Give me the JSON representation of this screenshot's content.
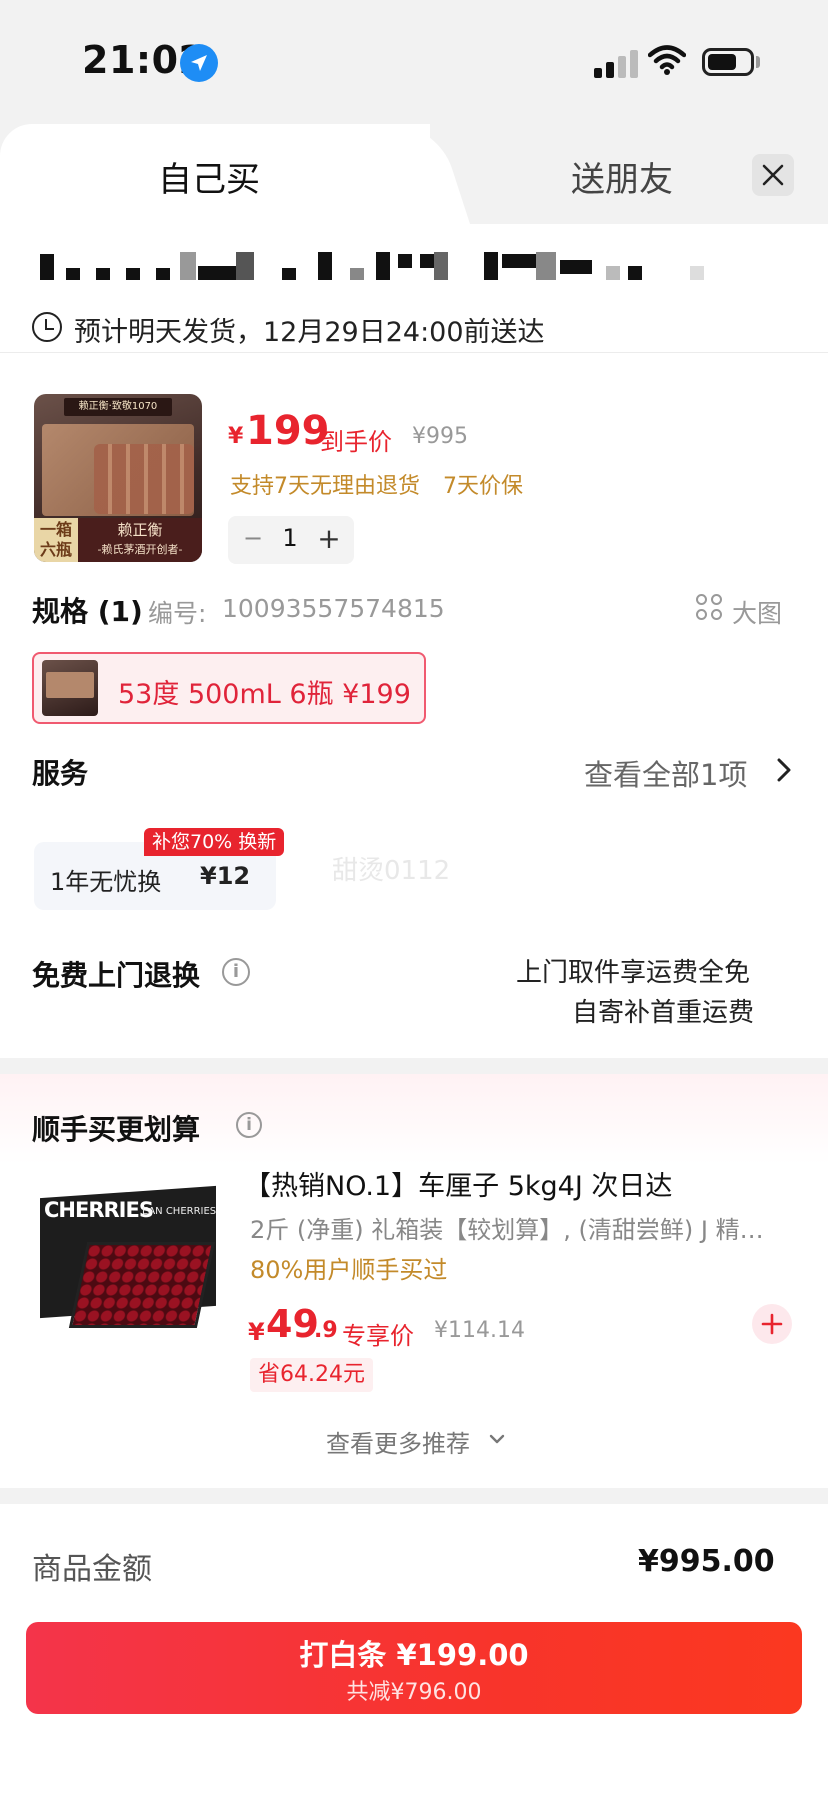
{
  "status_bar": {
    "time": "21:02"
  },
  "tabs": [
    {
      "label": "自己买",
      "active": true
    },
    {
      "label": "送朋友",
      "active": false
    }
  ],
  "delivery": {
    "text": "预计明天发货，12月29日24:00前送达"
  },
  "product": {
    "image_top_label": "赖正衡·致敬1070",
    "image_badge": "一箱六瓶",
    "image_brand": "赖正衡",
    "image_brand_sub": "-赖氏茅酒开创者-",
    "price_symbol": "¥",
    "price": "199",
    "price_tag": "到手价",
    "original_price": "¥995",
    "guarantees": [
      "支持7天无理由退货",
      "7天价保"
    ],
    "quantity": "1"
  },
  "spec": {
    "title": "规格 (1)",
    "code_label": "编号:",
    "code": "10093557574815",
    "big_image_label": "大图",
    "selected_option": "53度 500mL 6瓶  ¥199"
  },
  "service": {
    "title": "服务",
    "view_all": "查看全部1项",
    "card_name": "1年无忧换",
    "card_price": "¥12",
    "card_badge": "补您70% 换新",
    "watermark": "甜烫0112"
  },
  "free_return": {
    "title": "免费上门退换",
    "line1": "上门取件享运费全免",
    "line2": "自寄补首重运费"
  },
  "recommend": {
    "title": "顺手买更划算",
    "item_image_text": "CHERRIES",
    "item_image_text2": "EAN CHERRIES",
    "item_name": "【热销NO.1】车厘子 5kg4J 次日达",
    "item_desc": "2斤 (净重) 礼箱装【较划算】, (清甜尝鲜) J 精…",
    "item_social": "80%用户顺手买过",
    "price_symbol": "¥",
    "price_int": "49",
    "price_dec": ".9",
    "price_tag": "专享价",
    "original_price": "¥114.14",
    "save_text": "省64.24元",
    "more_label": "查看更多推荐"
  },
  "summary": {
    "amount_label": "商品金额",
    "amount_value": "¥995.00"
  },
  "pay_button": {
    "main_label": "打白条 ¥199.00",
    "sub_label": "共减¥796.00"
  },
  "colors": {
    "accent_red": "#e8242e",
    "gold": "#c38a2a",
    "button_gradient_start": "#f4344a",
    "button_gradient_end": "#fb3820"
  },
  "icons": [
    "location-arrow-icon",
    "signal-icon",
    "wifi-icon",
    "battery-icon",
    "close-icon",
    "clock-icon",
    "grid-icon",
    "chevron-right-icon",
    "info-icon",
    "plus-icon",
    "chevron-down-icon"
  ]
}
